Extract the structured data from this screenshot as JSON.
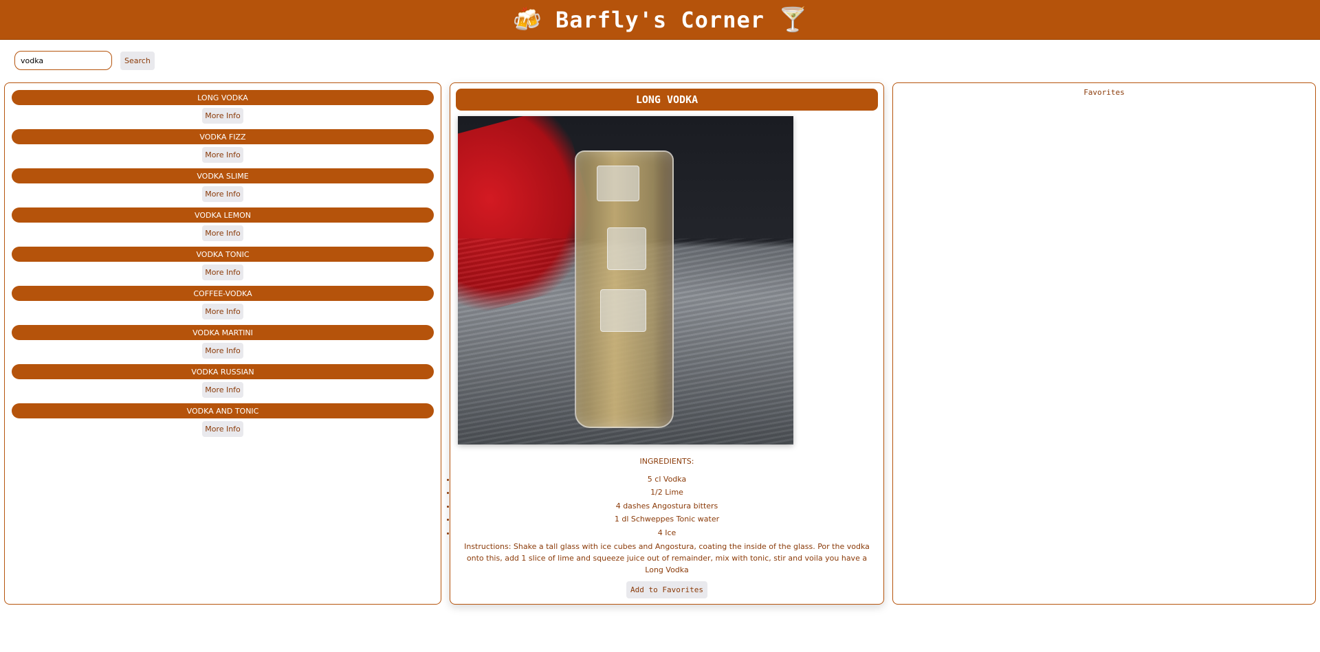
{
  "header": {
    "title": "Barfly's Corner",
    "left_emoji": "🍻",
    "right_emoji": "🍸"
  },
  "search": {
    "value": "vodka",
    "button_label": "Search"
  },
  "results": [
    {
      "name": "LONG VODKA",
      "button": "More Info"
    },
    {
      "name": "VODKA FIZZ",
      "button": "More Info"
    },
    {
      "name": "VODKA SLIME",
      "button": "More Info"
    },
    {
      "name": "VODKA LEMON",
      "button": "More Info"
    },
    {
      "name": "VODKA TONIC",
      "button": "More Info"
    },
    {
      "name": "COFFEE-VODKA",
      "button": "More Info"
    },
    {
      "name": "VODKA MARTINI",
      "button": "More Info"
    },
    {
      "name": "VODKA RUSSIAN",
      "button": "More Info"
    },
    {
      "name": "VODKA AND TONIC",
      "button": "More Info"
    }
  ],
  "detail": {
    "title": "LONG VODKA",
    "ingredients_label": "INGREDIENTS:",
    "ingredients": [
      "5 cl Vodka",
      "1/2 Lime",
      "4 dashes Angostura bitters",
      "1 dl Schweppes Tonic water",
      "4 Ice"
    ],
    "instructions": "Instructions: Shake a tall glass with ice cubes and Angostura, coating the inside of the glass. Por the vodka onto this, add 1 slice of lime and squeeze juice out of remainder, mix with tonic, stir and voila you have a Long Vodka",
    "add_button": "Add to Favorites"
  },
  "favorites": {
    "title": "Favorites"
  },
  "colors": {
    "brand": "#b5530b",
    "text": "#8a3a08"
  }
}
